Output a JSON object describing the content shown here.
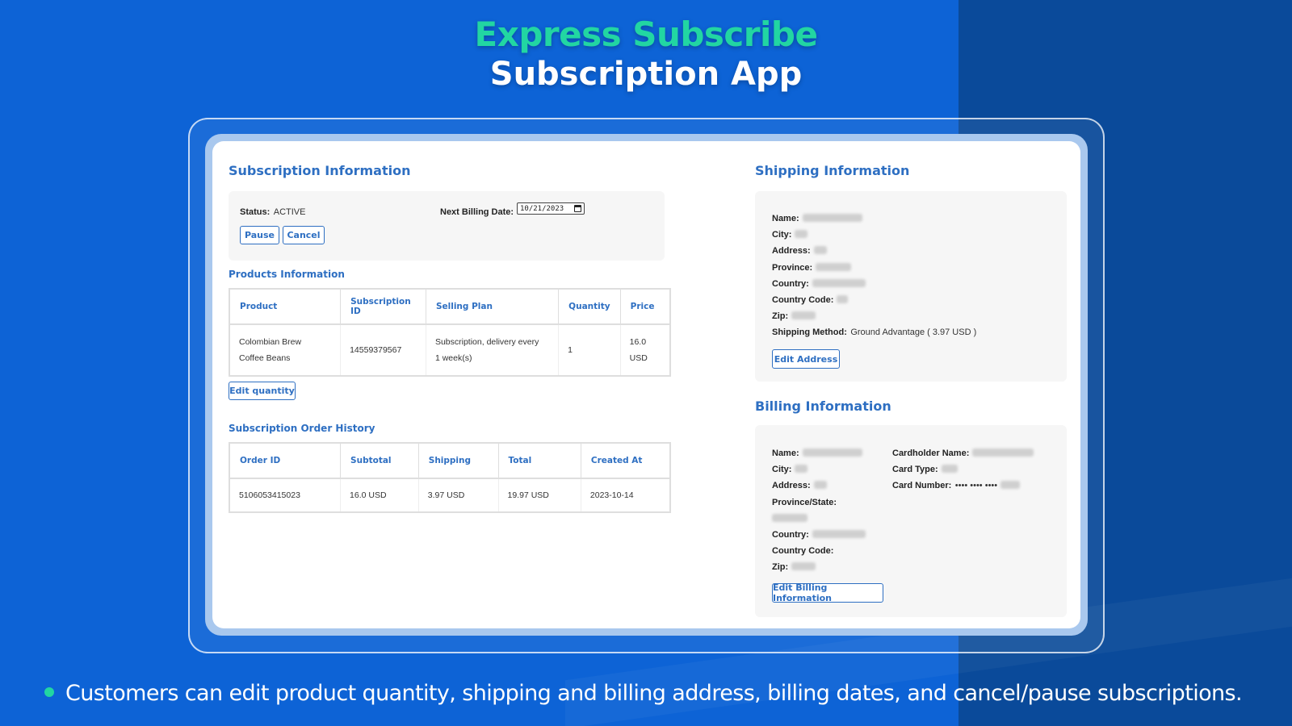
{
  "headline": {
    "line1": "Express Subscribe",
    "line2": "Subscription App"
  },
  "subscription": {
    "title": "Subscription Information",
    "status_label": "Status:",
    "status_value": "ACTIVE",
    "next_billing_label": "Next Billing Date:",
    "next_billing_value": "10/21/2023",
    "pause_label": "Pause",
    "cancel_label": "Cancel"
  },
  "products": {
    "title": "Products Information",
    "columns": [
      "Product",
      "Subscription ID",
      "Selling Plan",
      "Quantity",
      "Price"
    ],
    "rows": [
      {
        "product_line1": "Colombian Brew",
        "product_line2": "Coffee Beans",
        "subscription_id": "14559379567",
        "plan_line1": "Subscription, delivery every",
        "plan_line2": "1 week(s)",
        "quantity": "1",
        "price_line1": "16.0",
        "price_line2": "USD"
      }
    ],
    "edit_quantity_label": "Edit quantity"
  },
  "order_history": {
    "title": "Subscription Order History",
    "columns": [
      "Order ID",
      "Subtotal",
      "Shipping",
      "Total",
      "Created At"
    ],
    "rows": [
      {
        "order_id": "5106053415023",
        "subtotal": "16.0 USD",
        "shipping": "3.97 USD",
        "total": "19.97 USD",
        "created_at": "2023-10-14"
      }
    ]
  },
  "shipping": {
    "title": "Shipping Information",
    "name_label": "Name:",
    "city_label": "City:",
    "address_label": "Address:",
    "province_label": "Province:",
    "country_label": "Country:",
    "country_code_label": "Country Code:",
    "zip_label": "Zip:",
    "method_label": "Shipping Method:",
    "method_value": "Ground Advantage ( 3.97 USD )",
    "edit_address_label": "Edit Address"
  },
  "billing": {
    "title": "Billing Information",
    "name_label": "Name:",
    "city_label": "City:",
    "address_label": "Address:",
    "province_label": "Province/State:",
    "country_label": "Country:",
    "country_code_label": "Country Code:",
    "zip_label": "Zip:",
    "cardholder_label": "Cardholder Name:",
    "card_type_label": "Card Type:",
    "card_number_label": "Card Number:",
    "card_number_mask": "•••• •••• ••••",
    "edit_billing_label": "Edit Billing Information"
  },
  "footer": {
    "text": "Customers can edit product quantity, shipping and billing address, billing dates, and cancel/pause subscriptions."
  },
  "colors": {
    "background": "#0d63d6",
    "accent_green": "#22d6a2",
    "heading_blue": "#2e6fc2"
  }
}
